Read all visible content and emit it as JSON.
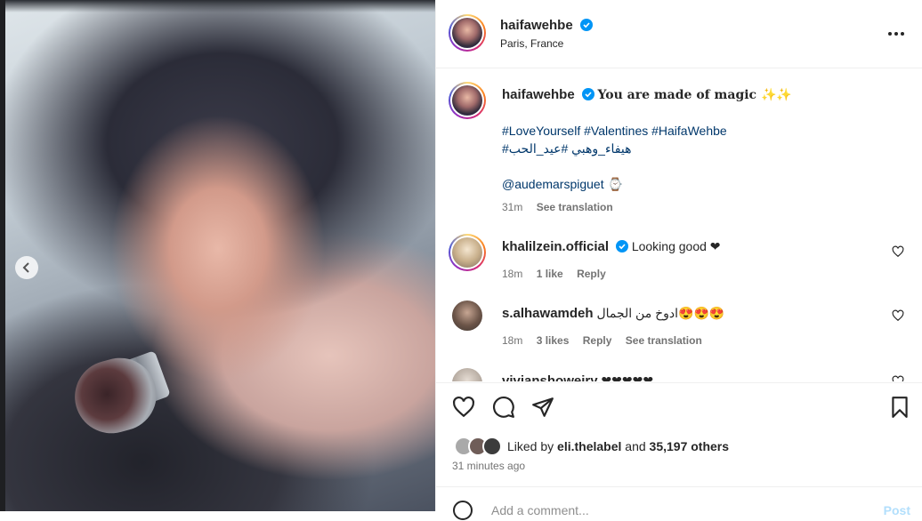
{
  "post": {
    "username": "haifawehbe",
    "location": "Paris, France"
  },
  "caption": {
    "username": "haifawehbe",
    "text": "You are made of magic ✨✨",
    "hashtags_line1": "#LoveYourself #Valentines #HaifaWehbe",
    "hashtags_line2": "#هيفاء_وهبي #عيد_الحب",
    "mention": "@audemarspiguet ⌚",
    "time": "31m",
    "see_translation": "See translation"
  },
  "comments": [
    {
      "username": "khalilzein.official",
      "verified": true,
      "text": "Looking good ❤",
      "time": "18m",
      "likes": "1 like",
      "reply": "Reply"
    },
    {
      "username": "s.alhawamdeh",
      "verified": false,
      "text": "ادوخ من الجمال😍😍😍",
      "time": "18m",
      "likes": "3 likes",
      "reply": "Reply",
      "see_translation": "See translation"
    },
    {
      "username": "vivianshoweiry",
      "verified": false,
      "text": "❤❤❤❤❤"
    }
  ],
  "likes": {
    "prefix": "Liked by",
    "user": "eli.thelabel",
    "and": "and",
    "count": "35,197 others"
  },
  "time_ago": "31 minutes ago",
  "add_comment": {
    "placeholder": "Add a comment...",
    "post": "Post"
  },
  "colors": {
    "verified": "#0095f6",
    "link": "#00376b",
    "muted": "#737373"
  },
  "icons": [
    "chevron-left-icon",
    "verified-badge-icon",
    "more-icon",
    "heart-icon",
    "comment-icon",
    "share-icon",
    "bookmark-icon",
    "emoji-icon"
  ]
}
